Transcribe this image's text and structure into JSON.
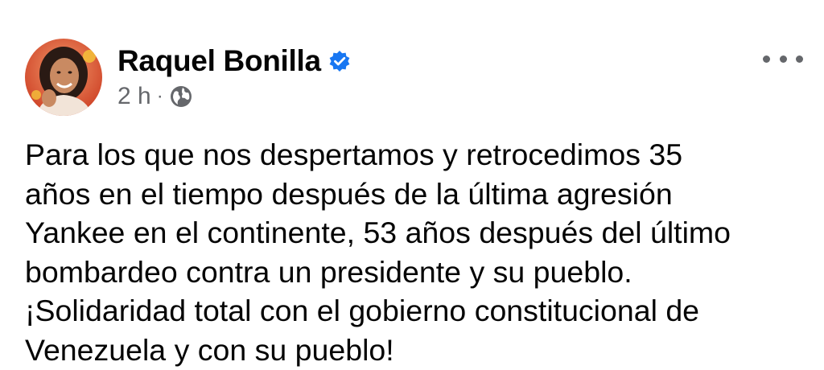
{
  "post": {
    "author": "Raquel Bonilla",
    "time": "2 h",
    "separator": "·",
    "privacy_icon": "globe-icon",
    "verified_icon": "verified-badge-icon",
    "more_icon": "more-options-icon",
    "body_lines": [
      "Para los que nos despertamos y retrocedimos 35",
      "años en el tiempo después de la última agresión",
      "Yankee en el continente, 53 años después del último",
      "bombardeo contra un presidente y su pueblo.",
      "¡Solidaridad total con el gobierno constitucional de",
      "Venezuela y con su pueblo!"
    ]
  },
  "colors": {
    "text": "#050505",
    "secondary_text": "#65676b",
    "verified_blue": "#1877f2",
    "avatar_ring": "#e8542a"
  }
}
